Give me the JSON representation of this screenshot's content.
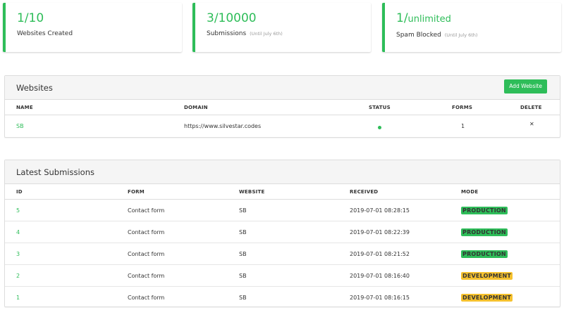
{
  "stats": [
    {
      "value_main": "1/10",
      "value_suffix": "",
      "label": "Websites Created",
      "note": ""
    },
    {
      "value_main": "3/10000",
      "value_suffix": "",
      "label": "Submissions",
      "note": "(Until July 6th)"
    },
    {
      "value_main": "1/",
      "value_suffix": "unlimited",
      "label": "Spam Blocked",
      "note": "(Until July 6th)"
    }
  ],
  "websites_panel": {
    "title": "Websites",
    "add_button": "Add Website",
    "columns": [
      "NAME",
      "DOMAIN",
      "STATUS",
      "FORMS",
      "DELETE"
    ],
    "rows": [
      {
        "name": "SB",
        "domain": "https://www.silvestar.codes",
        "status": "active",
        "forms": "1",
        "delete": "✕"
      }
    ]
  },
  "submissions_panel": {
    "title": "Latest Submissions",
    "columns": [
      "ID",
      "FORM",
      "WEBSITE",
      "RECEIVED",
      "MODE"
    ],
    "rows": [
      {
        "id": "5",
        "form": "Contact form",
        "website": "SB",
        "received": "2019-07-01 08:28:15",
        "mode": "PRODUCTION"
      },
      {
        "id": "4",
        "form": "Contact form",
        "website": "SB",
        "received": "2019-07-01 08:22:39",
        "mode": "PRODUCTION"
      },
      {
        "id": "3",
        "form": "Contact form",
        "website": "SB",
        "received": "2019-07-01 08:21:52",
        "mode": "PRODUCTION"
      },
      {
        "id": "2",
        "form": "Contact form",
        "website": "SB",
        "received": "2019-07-01 08:16:40",
        "mode": "DEVELOPMENT"
      },
      {
        "id": "1",
        "form": "Contact form",
        "website": "SB",
        "received": "2019-07-01 08:16:15",
        "mode": "DEVELOPMENT"
      }
    ]
  },
  "colors": {
    "accent": "#2ebd59",
    "delete": "#e0392b",
    "badge_production": "#2ebd59",
    "badge_development": "#f5c12e"
  }
}
